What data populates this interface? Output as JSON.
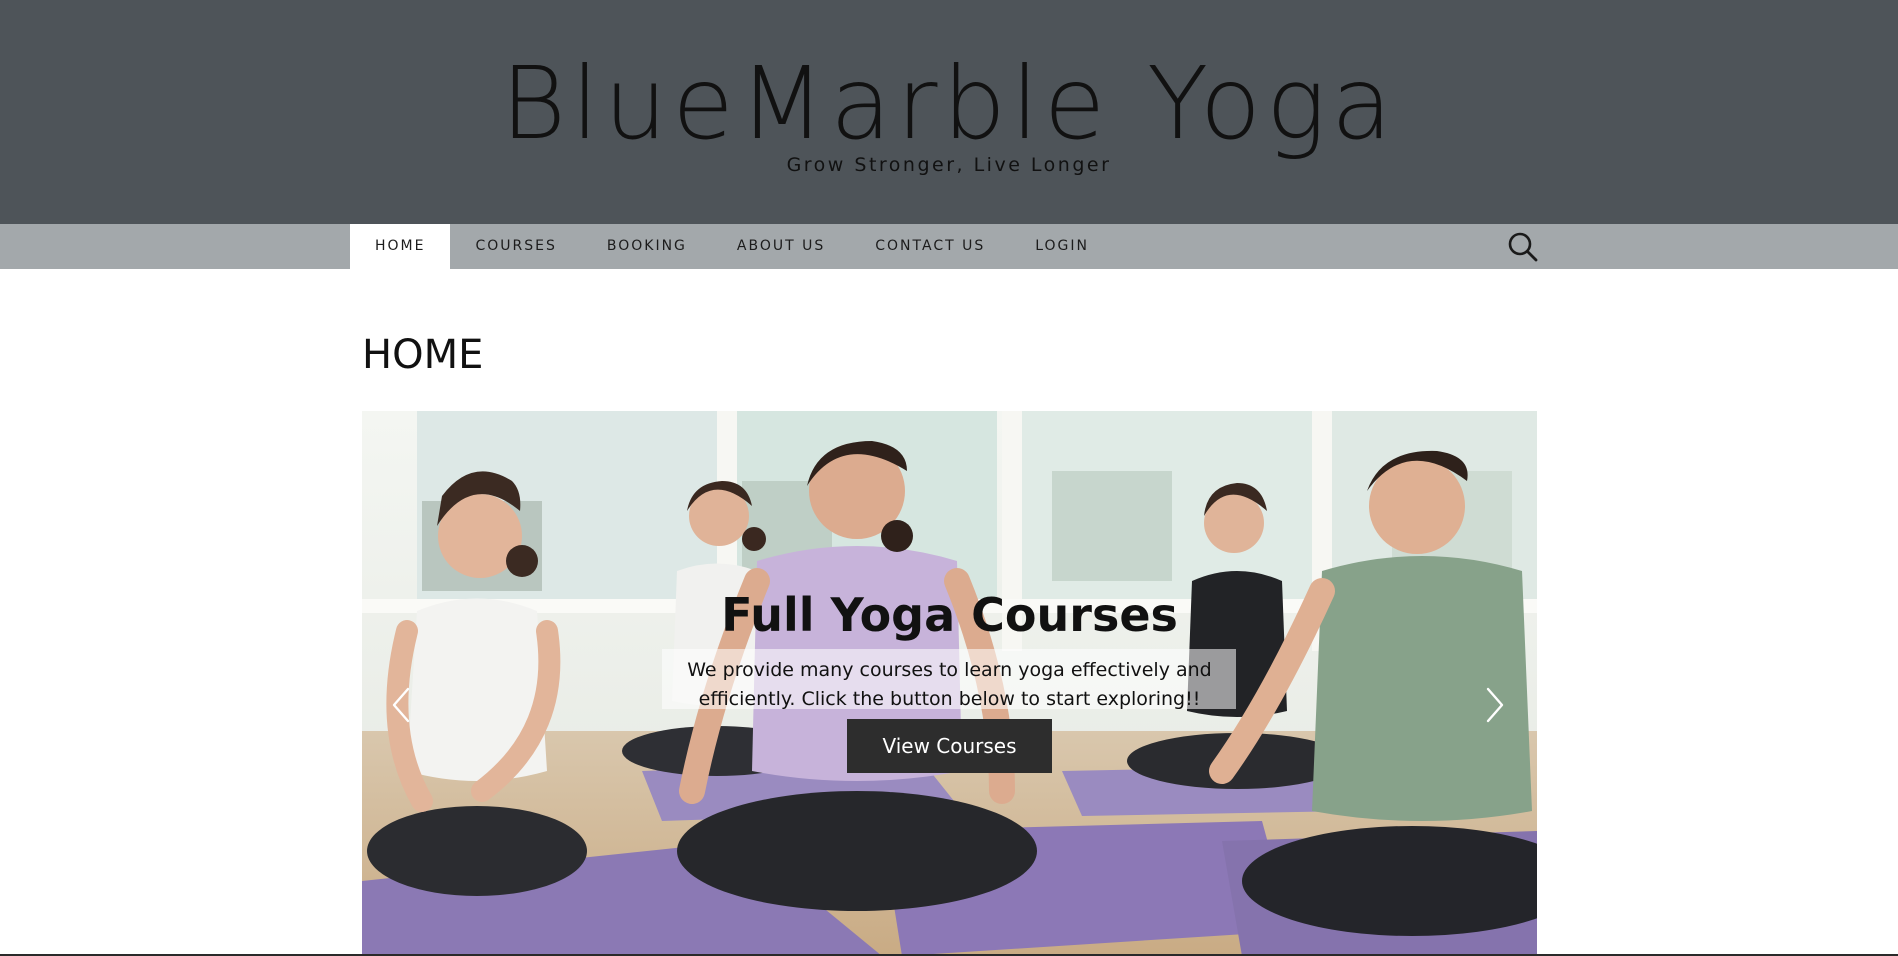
{
  "header": {
    "site_title": "BlueMarble Yoga",
    "tagline": "Grow Stronger, Live Longer"
  },
  "nav": {
    "items": [
      {
        "label": "HOME",
        "active": true
      },
      {
        "label": "COURSES",
        "active": false
      },
      {
        "label": "BOOKING",
        "active": false
      },
      {
        "label": "ABOUT US",
        "active": false
      },
      {
        "label": "CONTACT US",
        "active": false
      },
      {
        "label": "LOGIN",
        "active": false
      }
    ],
    "search_icon": "search-icon"
  },
  "page": {
    "title": "HOME"
  },
  "slider": {
    "caption_title": "Full Yoga Courses",
    "caption_line1": "We provide many courses to learn yoga effectively and",
    "caption_line2": "efficiently. Click the button below to start exploring!!",
    "button_label": "View Courses",
    "prev_icon": "chevron-left-icon",
    "next_icon": "chevron-right-icon",
    "image": "yoga-class-meditation-photo"
  },
  "colors": {
    "header_bg": "#4e5459",
    "nav_bg": "#a3a8ab",
    "active_tab_bg": "#ffffff",
    "button_bg": "#2d2d2d"
  }
}
